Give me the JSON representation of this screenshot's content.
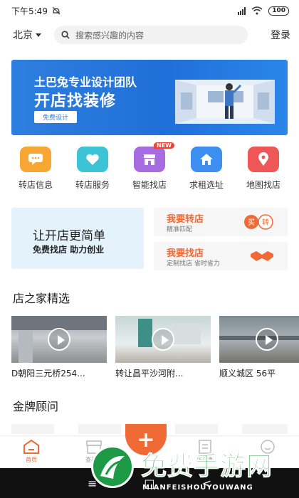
{
  "status": {
    "time": "下午5:49",
    "battery": "100"
  },
  "header": {
    "city": "北京",
    "search_placeholder": "搜索感兴趣的内容",
    "login": "登录"
  },
  "banner": {
    "line1": "土巴兔专业设计团队",
    "line2": "开店找装修",
    "button": "免费设计"
  },
  "categories": [
    {
      "label": "转店信息",
      "icon": "chat-icon",
      "color": "#f7a533"
    },
    {
      "label": "转店服务",
      "icon": "heart-icon",
      "color": "#3cc4d6"
    },
    {
      "label": "智能找店",
      "icon": "store-icon",
      "color": "#a66be0",
      "badge": "NEW"
    },
    {
      "label": "求租选址",
      "icon": "home-icon",
      "color": "#3c8ef0"
    },
    {
      "label": "地图找店",
      "icon": "map-pin-icon",
      "color": "#ef5656"
    }
  ],
  "promo": {
    "title": "让开店更简单",
    "subtitle": "免费找店 助力创业"
  },
  "side_cards": [
    {
      "title": "我要转店",
      "subtitle": "精准匹配",
      "icon": "transfer-icon",
      "icon_text_1": "买",
      "icon_text_2": "转"
    },
    {
      "title": "我要找店",
      "subtitle": "定制找店 省时省力",
      "icon": "handshake-icon"
    }
  ],
  "section_featured": "店之家精选",
  "shops": [
    {
      "caption": "D朝阳三元桥254..."
    },
    {
      "caption": "转让昌平沙河附..."
    },
    {
      "caption": "顺义城区 56平"
    }
  ],
  "section_advisors": "金牌顾问",
  "tabs": [
    {
      "label": "首页",
      "icon": "home-tab-icon",
      "active": true
    },
    {
      "label": "查看店",
      "icon": "shop-tab-icon",
      "active": false
    },
    {
      "label": "店头条",
      "icon": "news-tab-icon",
      "active": false
    },
    {
      "label": "",
      "icon": "profile-tab-icon",
      "active": false
    }
  ],
  "fab": "+",
  "nav": {
    "menu": "≡",
    "home": "□",
    "back": "<"
  },
  "watermark": {
    "title": "免费手游网",
    "sub": "MIANFEISHOUYOUWANG"
  },
  "colors": {
    "accent": "#f06a36",
    "banner_blue": "#2f7fe0"
  }
}
